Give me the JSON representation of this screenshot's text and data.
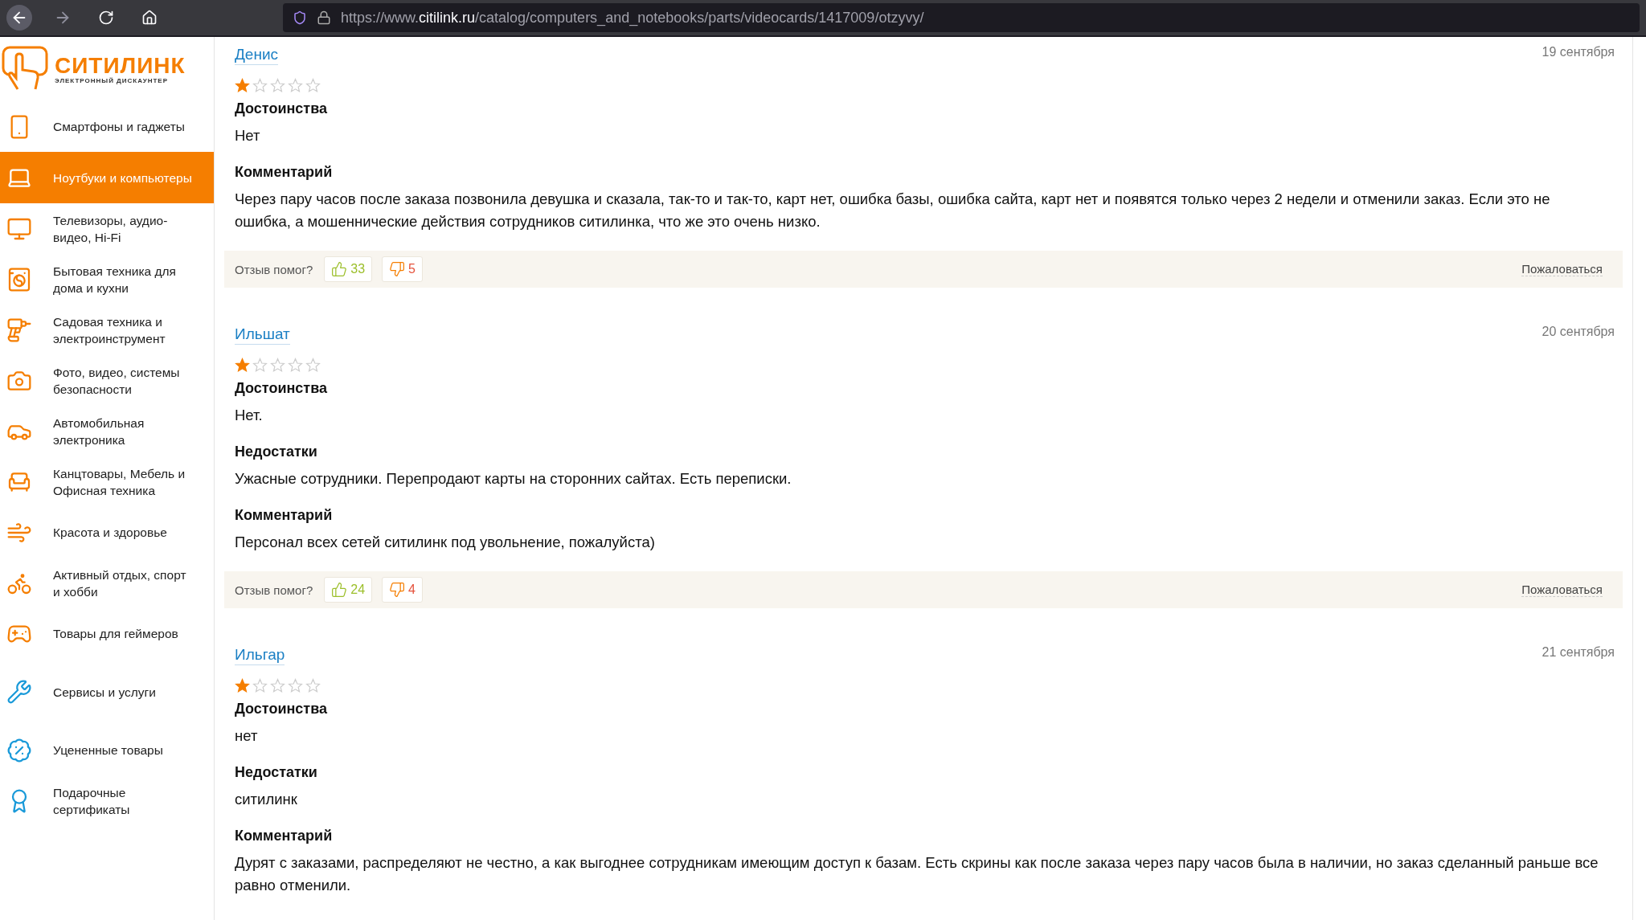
{
  "browser": {
    "url": {
      "prefix": "https://www.",
      "domain": "citilink.ru",
      "path": "/catalog/computers_and_notebooks/parts/videocards/1417009/otzyvy/"
    }
  },
  "logo": {
    "name": "СИТИЛИНК",
    "tagline": "ЭЛЕКТРОННЫЙ ДИСКАУНТЕР"
  },
  "sidebar": {
    "items": [
      {
        "label": "Смартфоны и гаджеты",
        "kind": "phone",
        "color": "#f57e00",
        "selected": false
      },
      {
        "label": "Ноутбуки и компьютеры",
        "kind": "laptop",
        "selected": true
      },
      {
        "label": "Телевизоры, аудио-видео, Hi-Fi",
        "kind": "tv",
        "color": "#f57e00",
        "selected": false
      },
      {
        "label": "Бытовая техника для дома и кухни",
        "kind": "washer",
        "color": "#f57e00",
        "selected": false
      },
      {
        "label": "Садовая техника и электроинструмент",
        "kind": "drill",
        "color": "#f57e00",
        "selected": false
      },
      {
        "label": "Фото, видео, системы безопасности",
        "kind": "camera",
        "color": "#f57e00",
        "selected": false
      },
      {
        "label": "Автомобильная электроника",
        "kind": "car",
        "color": "#f57e00",
        "selected": false
      },
      {
        "label": "Канцтовары, Мебель и Офисная техника",
        "kind": "chair",
        "color": "#f57e00",
        "selected": false
      },
      {
        "label": "Красота и здоровье",
        "kind": "dryer",
        "color": "#f57e00",
        "selected": false
      },
      {
        "label": "Активный отдых, спорт и хобби",
        "kind": "bike",
        "color": "#f57e00",
        "selected": false
      },
      {
        "label": "Товары для геймеров",
        "kind": "gamepad",
        "color": "#f57e00",
        "selected": false
      },
      {
        "label": "Сервисы и услуги",
        "kind": "service",
        "color": "#1a9ad9",
        "selected": false
      },
      {
        "label": "Уцененные товары",
        "kind": "discount",
        "color": "#1a9ad9",
        "selected": false
      },
      {
        "label": "Подарочные сертификаты",
        "kind": "certificate",
        "color": "#1a9ad9",
        "selected": false
      }
    ]
  },
  "reviews": [
    {
      "author": "Денис",
      "date": "19 сентября",
      "stars": 1,
      "sections": [
        {
          "heading": "Достоинства",
          "text": "Нет"
        },
        {
          "heading": "Комментарий",
          "text": "Через пару часов после заказа позвонила девушка и сказала, так-то и так-то, карт нет, ошибка базы, ошибка сайта, карт нет и появятся только через 2 недели и отменили заказ. Если это не ошибка, а мошеннические действия сотрудников ситилинка, что же это очень низко."
        }
      ],
      "votes": {
        "question": "Отзыв помог?",
        "likes": "33",
        "dislikes": "5",
        "report": "Пожаловаться"
      }
    },
    {
      "author": "Ильшат",
      "date": "20 сентября",
      "stars": 1,
      "sections": [
        {
          "heading": "Достоинства",
          "text": "Нет."
        },
        {
          "heading": "Недостатки",
          "text": "Ужасные сотрудники. Перепродают карты на сторонних сайтах. Есть переписки."
        },
        {
          "heading": "Комментарий",
          "text": "Персонал всех сетей ситилинк под увольнение, пожалуйста)"
        }
      ],
      "votes": {
        "question": "Отзыв помог?",
        "likes": "24",
        "dislikes": "4",
        "report": "Пожаловаться"
      }
    },
    {
      "author": "Ильгар",
      "date": "21 сентября",
      "stars": 1,
      "sections": [
        {
          "heading": "Достоинства",
          "text": "нет"
        },
        {
          "heading": "Недостатки",
          "text": "ситилинк"
        },
        {
          "heading": "Комментарий",
          "text": "Дурят с заказами, распределяют не честно, а как выгоднее сотрудникам имеющим доступ к базам. Есть скрины как после заказа через пару часов была в наличии, но заказ сделанный раньше все равно отменили."
        }
      ]
    }
  ]
}
